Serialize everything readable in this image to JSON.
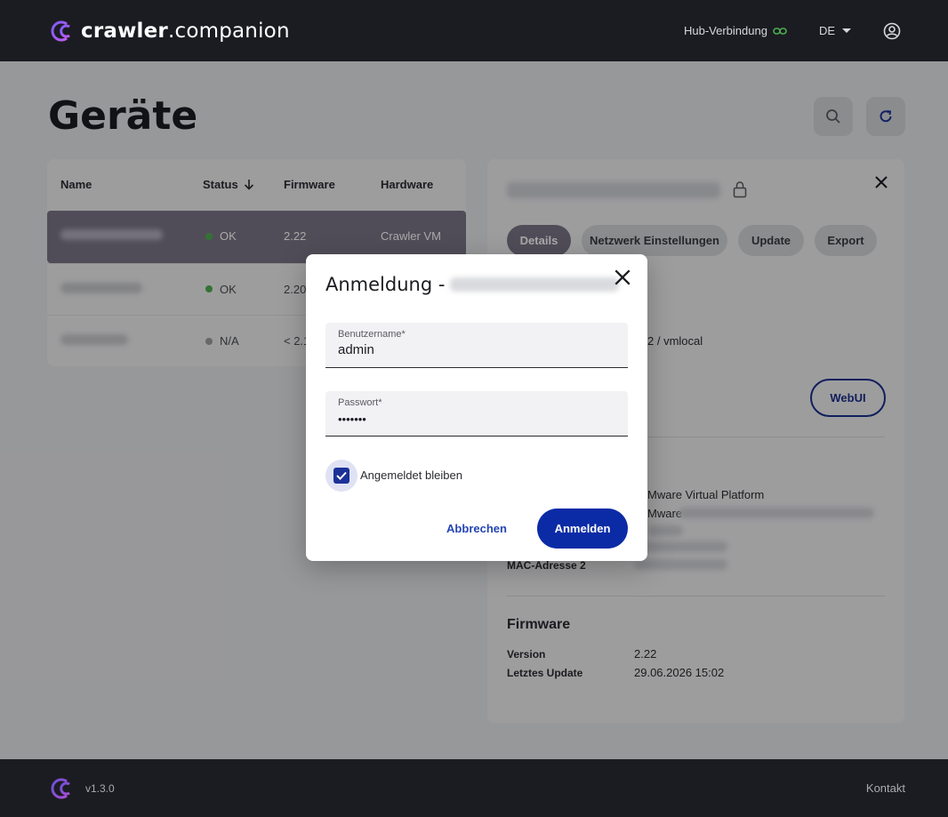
{
  "header": {
    "logo_bold": "crawler",
    "logo_rest": ".companion",
    "hub_label": "Hub-Verbindung",
    "language": "DE",
    "accent": "#4caf50"
  },
  "page": {
    "title": "Geräte"
  },
  "table": {
    "columns": {
      "name": "Name",
      "status": "Status",
      "firmware": "Firmware",
      "hardware": "Hardware"
    },
    "rows": [
      {
        "status": "OK",
        "firmware": "2.22",
        "hardware": "Crawler VM",
        "status_color": "#4caf50"
      },
      {
        "status": "OK",
        "firmware": "2.20",
        "hardware": "",
        "status_color": "#4caf50"
      },
      {
        "status": "N/A",
        "firmware": "< 2.1",
        "hardware": "",
        "status_color": "#9e9e9e"
      }
    ]
  },
  "details": {
    "tabs": [
      "Details",
      "Netzwerk Einstellungen",
      "Update",
      "Export"
    ],
    "host_partial": "2 / vmlocal",
    "webui_label": "WebUI",
    "platform_1": "Mware Virtual Platform",
    "platform_2": "Mware",
    "mac2_label": "MAC-Adresse 2",
    "firmware_section": "Firmware",
    "version_label": "Version",
    "version_value": "2.22",
    "last_update_label": "Letztes Update",
    "last_update_value": "29.06.2026 15:02"
  },
  "modal": {
    "title_prefix": "Anmeldung -",
    "username_label": "Benutzername*",
    "username_value": "admin",
    "password_label": "Passwort*",
    "password_value": "•••••••",
    "remember_label": "Angemeldet bleiben",
    "cancel_label": "Abbrechen",
    "login_label": "Anmelden"
  },
  "footer": {
    "version": "v1.3.0",
    "contact": "Kontakt"
  }
}
